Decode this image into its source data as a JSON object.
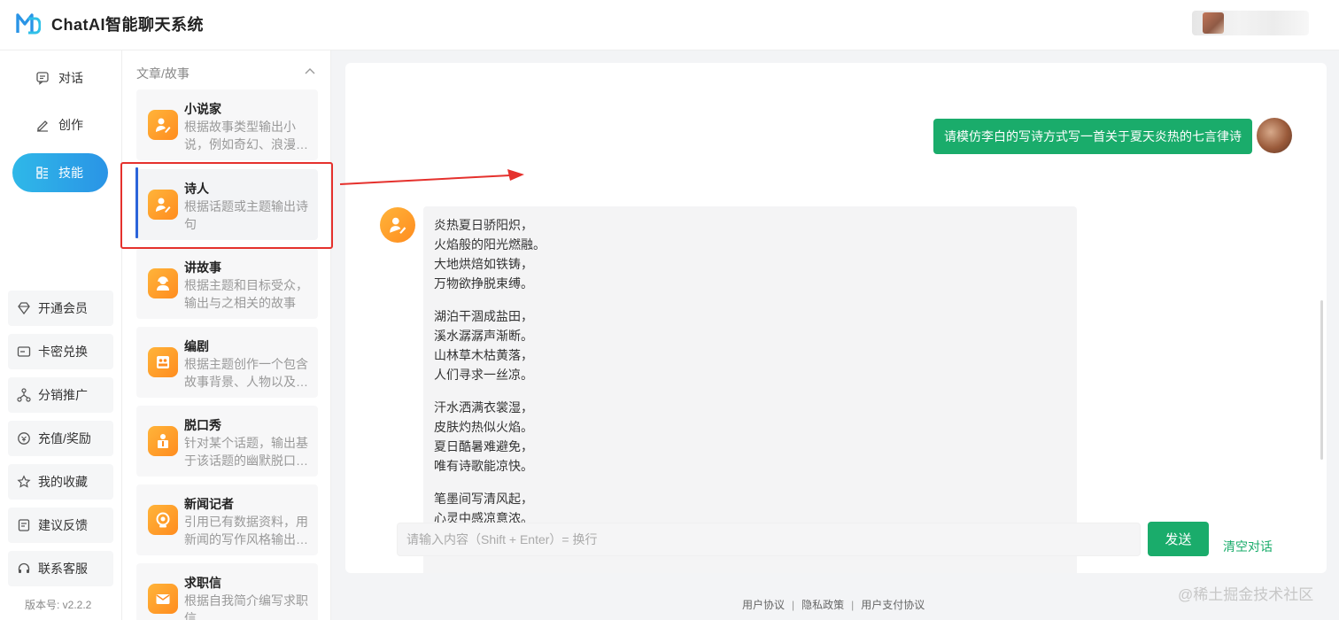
{
  "header": {
    "title": "ChatAI智能聊天系统"
  },
  "nav": {
    "items": [
      {
        "label": "对话",
        "icon": "chat-icon"
      },
      {
        "label": "创作",
        "icon": "edit-icon"
      },
      {
        "label": "技能",
        "icon": "skills-icon",
        "active": true
      }
    ],
    "menu": [
      {
        "label": "开通会员",
        "icon": "diamond-icon"
      },
      {
        "label": "卡密兑换",
        "icon": "card-icon"
      },
      {
        "label": "分销推广",
        "icon": "share-icon"
      },
      {
        "label": "充值/奖励",
        "icon": "recharge-icon"
      },
      {
        "label": "我的收藏",
        "icon": "star-icon"
      },
      {
        "label": "建议反馈",
        "icon": "feedback-icon"
      },
      {
        "label": "联系客服",
        "icon": "headset-icon"
      }
    ],
    "version": "版本号: v2.2.2"
  },
  "skills": {
    "category": "文章/故事",
    "items": [
      {
        "name": "小说家",
        "desc": "根据故事类型输出小说，例如奇幻、浪漫…"
      },
      {
        "name": "诗人",
        "desc": "根据话题或主题输出诗句",
        "active": true
      },
      {
        "name": "讲故事",
        "desc": "根据主题和目标受众，输出与之相关的故事"
      },
      {
        "name": "编剧",
        "desc": "根据主题创作一个包含故事背景、人物以及…"
      },
      {
        "name": "脱口秀",
        "desc": "针对某个话题，输出基于该话题的幽默脱口…"
      },
      {
        "name": "新闻记者",
        "desc": "引用已有数据资料，用新闻的写作风格输出…"
      },
      {
        "name": "求职信",
        "desc": "根据自我简介编写求职信"
      }
    ]
  },
  "chat": {
    "user_message": "请模仿李白的写诗方式写一首关于夏天炎热的七言律诗",
    "bot_stanzas": [
      [
        "炎热夏日骄阳炽，",
        "火焰般的阳光燃融。",
        "大地烘焙如铁铸，",
        "万物欲挣脱束缚。"
      ],
      [
        "湖泊干涸成盐田，",
        "溪水潺潺声渐断。",
        "山林草木枯黄落，",
        "人们寻求一丝凉。"
      ],
      [
        "汗水洒满衣裳湿，",
        "皮肤灼热似火焰。",
        "夏日酷暑难避免，",
        "唯有诗歌能凉快。"
      ],
      [
        "笔墨间写清风起，",
        "心灵中感凉意浓。"
      ]
    ],
    "input_placeholder": "请输入内容（Shift + Enter）= 换行",
    "send_label": "发送",
    "clear_label": "清空对话"
  },
  "footer": {
    "links": [
      "用户协议",
      "隐私政策",
      "用户支付协议"
    ]
  },
  "watermark": "@稀土掘金技术社区",
  "colors": {
    "accent_green": "#1aac6b",
    "nav_active": "#2a94e6",
    "skill_orange": "#ff8c1f",
    "annotation_red": "#e5312d"
  }
}
